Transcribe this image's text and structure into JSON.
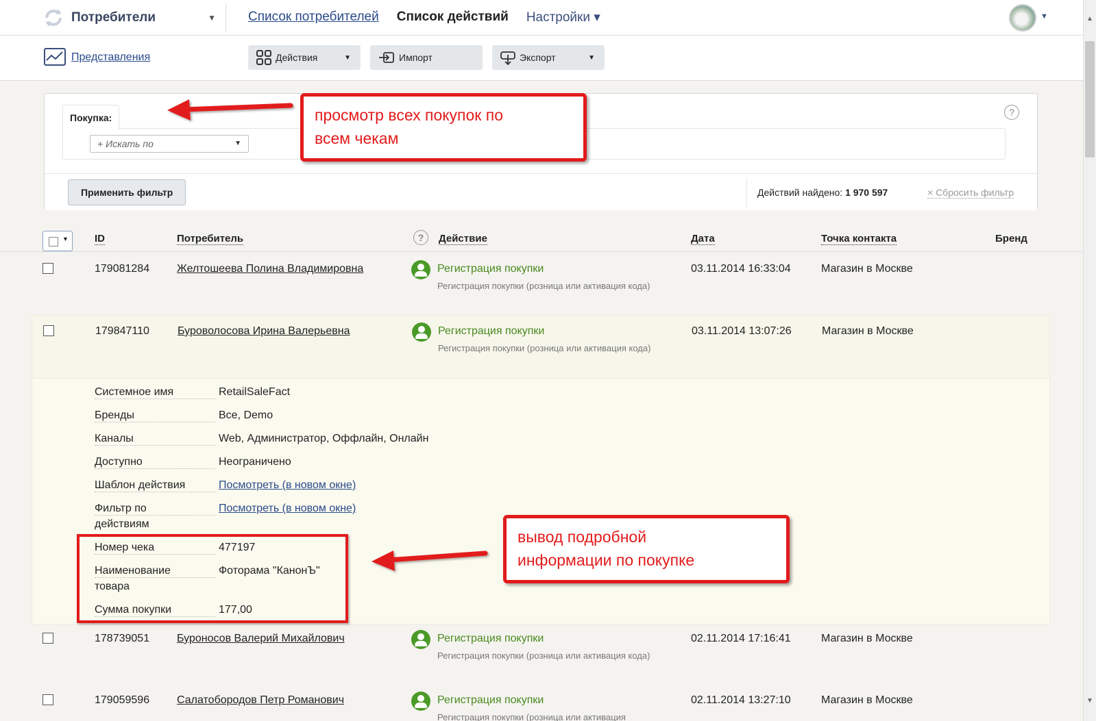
{
  "header": {
    "app_name": "Потребители",
    "nav": [
      {
        "label": "Список потребителей"
      },
      {
        "label": "Список действий"
      },
      {
        "label": "Настройки ▾"
      }
    ]
  },
  "toolbar": {
    "views_label": "Представления",
    "actions_label": "Действия",
    "import_label": "Импорт",
    "export_label": "Экспорт"
  },
  "filter": {
    "tab_label": "Покупка:",
    "search_by_placeholder": "+ Искать по",
    "apply_label": "Применить фильтр",
    "found_label": "Действий найдено:",
    "found_count": "1 970 597",
    "reset_label": "× Сбросить фильтр"
  },
  "table": {
    "columns": {
      "id": "ID",
      "consumer": "Потребитель",
      "action": "Действие",
      "date": "Дата",
      "contact_point": "Точка контакта",
      "brand": "Бренд"
    },
    "rows": [
      {
        "id": "179081284",
        "consumer": "Желтошеева Полина Владимировна",
        "action": "Регистрация покупки",
        "action_sub": "Регистрация покупки (розница или активация кода)",
        "date": "03.11.2014 16:33:04",
        "contact_point": "Магазин в Москве"
      },
      {
        "id": "179847110",
        "consumer": "Буроволосова Ирина Валерьевна",
        "action": "Регистрация покупки",
        "action_sub": "Регистрация покупки (розница или активация кода)",
        "date": "03.11.2014 13:07:26",
        "contact_point": "Магазин в Москве"
      },
      {
        "id": "178739051",
        "consumer": "Буроносов Валерий Михайлович",
        "action": "Регистрация покупки",
        "action_sub": "Регистрация покупки (розница или активация кода)",
        "date": "02.11.2014 17:16:41",
        "contact_point": "Магазин в Москве"
      },
      {
        "id": "179059596",
        "consumer": "Салатобородов Петр Романович",
        "action": "Регистрация покупки",
        "action_sub": "Регистрация покупки (розница или активация",
        "date": "02.11.2014 13:27:10",
        "contact_point": "Магазин в Москве"
      }
    ]
  },
  "details": [
    {
      "label": "Системное имя",
      "value": "RetailSaleFact"
    },
    {
      "label": "Бренды",
      "value": "Все, Demo"
    },
    {
      "label": "Каналы",
      "value": "Web, Администратор, Оффлайн, Онлайн"
    },
    {
      "label": "Доступно",
      "value": "Неограничено"
    },
    {
      "label": "Шаблон действия",
      "value": "Посмотреть (в новом окне)"
    },
    {
      "label_l1": "Фильтр по",
      "label_l2": "действиям",
      "value": "Посмотреть (в новом окне)"
    },
    {
      "label": "Номер чека",
      "value": "477197"
    },
    {
      "label_l1": "Наименование",
      "label_l2": "товара",
      "value": "Фоторама \"КанонЪ\""
    },
    {
      "label": "Сумма покупки",
      "value": "177,00"
    }
  ],
  "annotations": {
    "filter_note_l1": "просмотр всех покупок по",
    "filter_note_l2": "всем чекам",
    "details_note_l1": "вывод подробной",
    "details_note_l2": "информации по покупке"
  },
  "colors": {
    "accent_red": "#e21b1b",
    "action_green": "#4a8a20",
    "link_blue": "#2a4a8a"
  }
}
